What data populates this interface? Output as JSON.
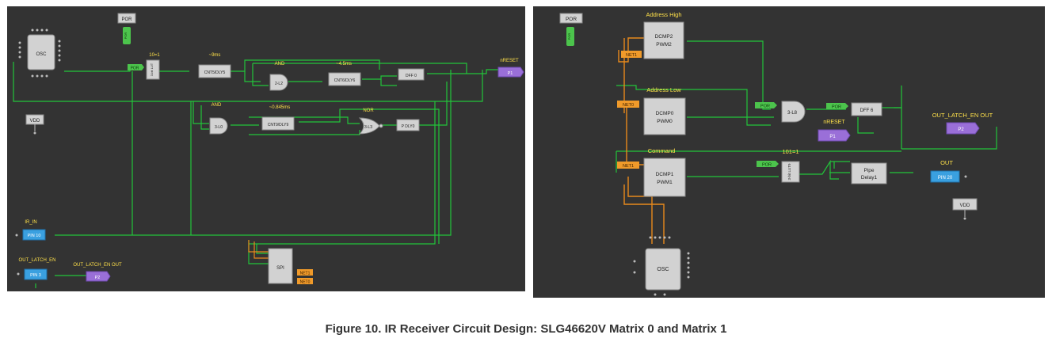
{
  "caption": "Figure 10. IR Receiver Circuit Design: SLG46620V Matrix 0 and Matrix 1",
  "colors": {
    "background": "#333333",
    "wire": "#22c43a",
    "orange_wire": "#e8891c",
    "label": "#ffe14a",
    "block": "#d2d2d2",
    "pin_blue": "#3aa0e0",
    "pin_purple": "#9a6fd8",
    "net_orange": "#f09a2a",
    "por_green": "#4cc44c"
  },
  "matrix0": {
    "osc": "OSC",
    "por_tag": "POR",
    "por_vert": "POR",
    "vdd": "VDD",
    "lut_1_label": "10=1",
    "lut_1_text": "3-bit LUT",
    "por_small": "POR",
    "cnt5_label": "~9ms",
    "cnt5": "CNT5/DLY5",
    "and_label_top": "AND",
    "and_gate_1": "2-L2",
    "delay_45_label": "~4.5ms",
    "cnt6": "CNT6/DLY6",
    "dff0": "DFF 0",
    "nreset_label": "nRESET",
    "p1": "P1",
    "and_label_mid": "AND",
    "and_gate_2": "3-L0",
    "delay_845_label": "~0.845ms",
    "cnt9": "CNT9/DLY9",
    "nor_label": "NOR",
    "nor_gate": "3-L3",
    "pdly0": "P DLY0",
    "ir_in_label": "IR_IN",
    "pin10": "PIN 10",
    "out_latch_label": "OUT_LATCH_EN",
    "pin3": "PIN 3",
    "out_latch_out_label": "OUT_LATCH_EN OUT",
    "p2": "P2",
    "spi": "SPI",
    "net1": "NET1",
    "net0": "NET0"
  },
  "matrix1": {
    "por_tag": "POR",
    "por_vert": "POR",
    "addr_high_label": "Address High",
    "dcmp2": "DCMP2",
    "pwm2": "PWM2",
    "net1_a": "NET1",
    "addr_low_label": "Address Low",
    "net0": "NET0",
    "dcmp0": "DCMP0",
    "pwm0": "PWM0",
    "por_a": "POR",
    "and_gate": "3-L8",
    "por_b": "POR",
    "dff6": "DFF 6",
    "nreset_label": "nRESET",
    "p1": "P1",
    "out_latch_label": "OUT_LATCH_EN OUT",
    "p2": "P2",
    "command_label": "Command",
    "lut_label": "101=1",
    "net1_b": "NET1",
    "dcmp1": "DCMP1",
    "pwm1": "PWM1",
    "por_c": "POR",
    "lut_text": "3-bit LUT9",
    "pipe": "Pipe",
    "pipe2": "Delay1",
    "out_label": "OUT",
    "pin20": "PIN 20",
    "vdd": "VDD",
    "osc": "OSC"
  }
}
